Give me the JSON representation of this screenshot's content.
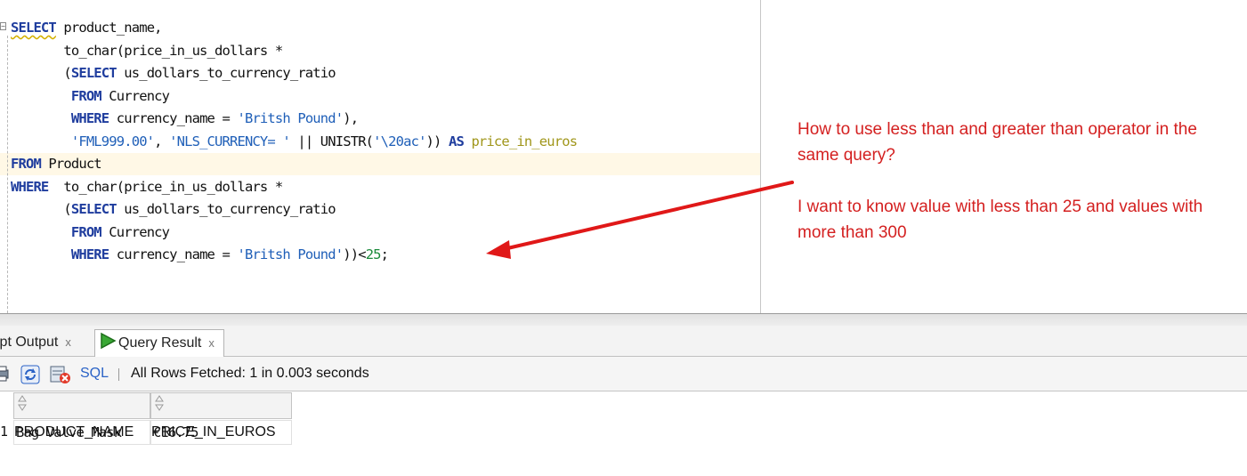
{
  "editor": {
    "lines": [
      [
        {
          "t": "SELECT",
          "c": "kw err"
        },
        {
          "t": " product_name,",
          "c": ""
        }
      ],
      [
        {
          "t": "       to_char(price_in_us_dollars *",
          "c": ""
        }
      ],
      [
        {
          "t": "       (",
          "c": ""
        },
        {
          "t": "SELECT",
          "c": "kw"
        },
        {
          "t": " us_dollars_to_currency_ratio",
          "c": ""
        }
      ],
      [
        {
          "t": "        ",
          "c": ""
        },
        {
          "t": "FROM",
          "c": "kw"
        },
        {
          "t": " Currency",
          "c": ""
        }
      ],
      [
        {
          "t": "        ",
          "c": ""
        },
        {
          "t": "WHERE",
          "c": "kw"
        },
        {
          "t": " currency_name = ",
          "c": ""
        },
        {
          "t": "'Britsh Pound'",
          "c": "str"
        },
        {
          "t": "),",
          "c": ""
        }
      ],
      [
        {
          "t": "        ",
          "c": ""
        },
        {
          "t": "'FML999.00'",
          "c": "str"
        },
        {
          "t": ", ",
          "c": ""
        },
        {
          "t": "'NLS_CURRENCY= '",
          "c": "str"
        },
        {
          "t": " || UNISTR(",
          "c": ""
        },
        {
          "t": "'\\20ac'",
          "c": "str"
        },
        {
          "t": ")) ",
          "c": ""
        },
        {
          "t": "AS",
          "c": "kw"
        },
        {
          "t": " ",
          "c": ""
        },
        {
          "t": "price_in_euros",
          "c": "alias"
        }
      ],
      [
        {
          "t": "FROM",
          "c": "kw"
        },
        {
          "t": " Product",
          "c": ""
        }
      ],
      [
        {
          "t": "WHERE",
          "c": "kw"
        },
        {
          "t": "  to_char(price_in_us_dollars *",
          "c": ""
        }
      ],
      [
        {
          "t": "       (",
          "c": ""
        },
        {
          "t": "SELECT",
          "c": "kw"
        },
        {
          "t": " us_dollars_to_currency_ratio",
          "c": ""
        }
      ],
      [
        {
          "t": "        ",
          "c": ""
        },
        {
          "t": "FROM",
          "c": "kw"
        },
        {
          "t": " Currency",
          "c": ""
        }
      ],
      [
        {
          "t": "        ",
          "c": ""
        },
        {
          "t": "WHERE",
          "c": "kw"
        },
        {
          "t": " currency_name = ",
          "c": ""
        },
        {
          "t": "'Britsh Pound'",
          "c": "str"
        },
        {
          "t": "))<",
          "c": ""
        },
        {
          "t": "25",
          "c": "num"
        },
        {
          "t": ";",
          "c": ""
        }
      ]
    ]
  },
  "annotation": {
    "question": "How to use less than and greater than operator in the same query?",
    "detail": "I want to know value with less than 25 and values with more than 300",
    "color": "#d42020"
  },
  "panel": {
    "tabs": [
      {
        "label": "ipt Output",
        "close": "x"
      },
      {
        "label": "Query Result",
        "close": "x",
        "icon": "play-icon"
      }
    ],
    "toolbar": {
      "sql_label": "SQL",
      "status": "All Rows Fetched: 1 in 0.003 seconds"
    },
    "grid": {
      "columns": [
        "PRODUCT_NAME",
        "PRICE_IN_EUROS"
      ],
      "rows": [
        {
          "num": "1",
          "cells": [
            "Bag Valve Mask",
            "€16.75"
          ]
        }
      ]
    }
  }
}
